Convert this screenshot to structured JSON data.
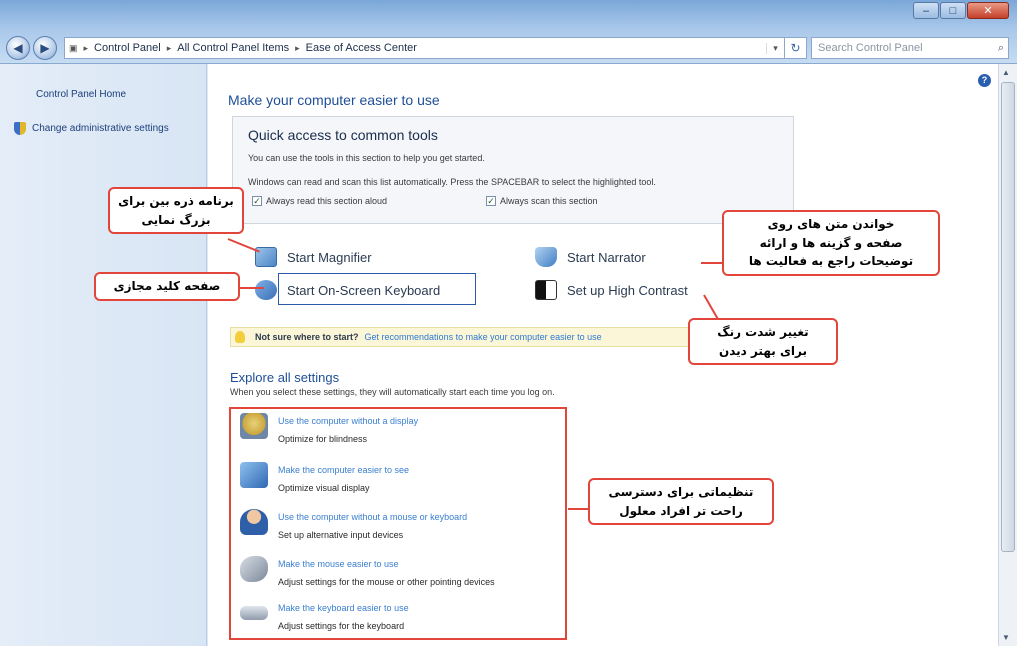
{
  "window": {
    "breadcrumb": [
      "Control Panel",
      "All Control Panel Items",
      "Ease of Access Center"
    ],
    "search_placeholder": "Search Control Panel",
    "caption_minimize": "–",
    "caption_maximize": "□",
    "caption_close": "✕"
  },
  "sidebar": {
    "home": "Control Panel Home",
    "admin": "Change administrative settings"
  },
  "main": {
    "title": "Make your computer easier to use",
    "quick_access": {
      "title": "Quick access to common tools",
      "text1": "You can use the tools in this section to help you get started.",
      "text2": "Windows can read and scan this list automatically. Press the SPACEBAR to select the highlighted tool.",
      "check_read": "Always read this section aloud",
      "check_scan": "Always scan this section"
    },
    "tools": {
      "magnifier": "Start Magnifier",
      "narrator": "Start Narrator",
      "osk": "Start On-Screen Keyboard",
      "contrast": "Set up High Contrast"
    },
    "notsure": {
      "question": "Not sure where to start?",
      "link": "Get recommendations to make your computer easier to use"
    },
    "explore": {
      "title": "Explore all settings",
      "subtitle": "When you select these settings, they will automatically start each time you log on."
    },
    "settings": [
      {
        "link": "Use the computer without a display",
        "desc": "Optimize for blindness"
      },
      {
        "link": "Make the computer easier to see",
        "desc": "Optimize visual display"
      },
      {
        "link": "Use the computer without a mouse or keyboard",
        "desc": "Set up alternative input devices"
      },
      {
        "link": "Make the mouse easier to use",
        "desc": "Adjust settings for the mouse or other pointing devices"
      },
      {
        "link": "Make the keyboard easier to use",
        "desc": "Adjust settings for the keyboard"
      }
    ]
  },
  "callouts": {
    "magnifier": "برنامه ذره بین برای\nبزرگ نمایی",
    "osk": "صفحه کلید مجازی",
    "narrator": "خواندن متن های روی\nصفحه و گزینه ها و ارائه\nتوضیحات راجع به فعالیت ها",
    "contrast": "تغییر شدت رنگ\nبرای بهتر دیدن",
    "settings": "تنظیماتی برای دسترسی\nراحت تر افراد معلول"
  },
  "colors": {
    "annotation_red": "#e2463a",
    "link_blue": "#3a7fd0",
    "heading_blue": "#1e4f98"
  }
}
